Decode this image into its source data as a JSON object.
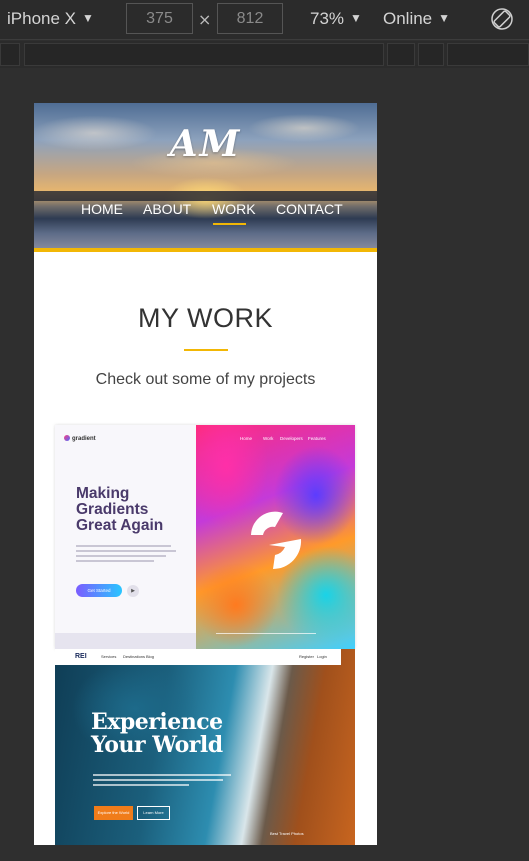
{
  "devtools": {
    "device": "iPhone X",
    "width": "375",
    "height": "812",
    "zoom": "73%",
    "throttle": "Online",
    "times": "×",
    "caret": "▼"
  },
  "site": {
    "logo": "AM",
    "nav": {
      "home": "HOME",
      "about": "ABOUT",
      "work": "WORK",
      "contact": "CONTACT",
      "active": "WORK"
    },
    "section_title": "MY WORK",
    "section_subtitle": "Check out some of my projects",
    "accent_color": "#f2b705"
  },
  "projects": [
    {
      "brand": "gradient",
      "headline_line1": "Making",
      "headline_line2": "Gradients",
      "headline_line3": "Great Again",
      "cta": "Get Started",
      "nav": [
        "Home",
        "Work",
        "Developers",
        "Features"
      ]
    },
    {
      "logo": "REI",
      "menu": [
        "Services",
        "Destinations",
        "Blog"
      ],
      "menu_right": [
        "Register",
        "Login"
      ],
      "headline_line1": "Experience",
      "headline_line2": "Your World",
      "btn_primary": "Explore the World",
      "btn_secondary": "Learn More",
      "caption": "Best Travel Photos"
    }
  ]
}
